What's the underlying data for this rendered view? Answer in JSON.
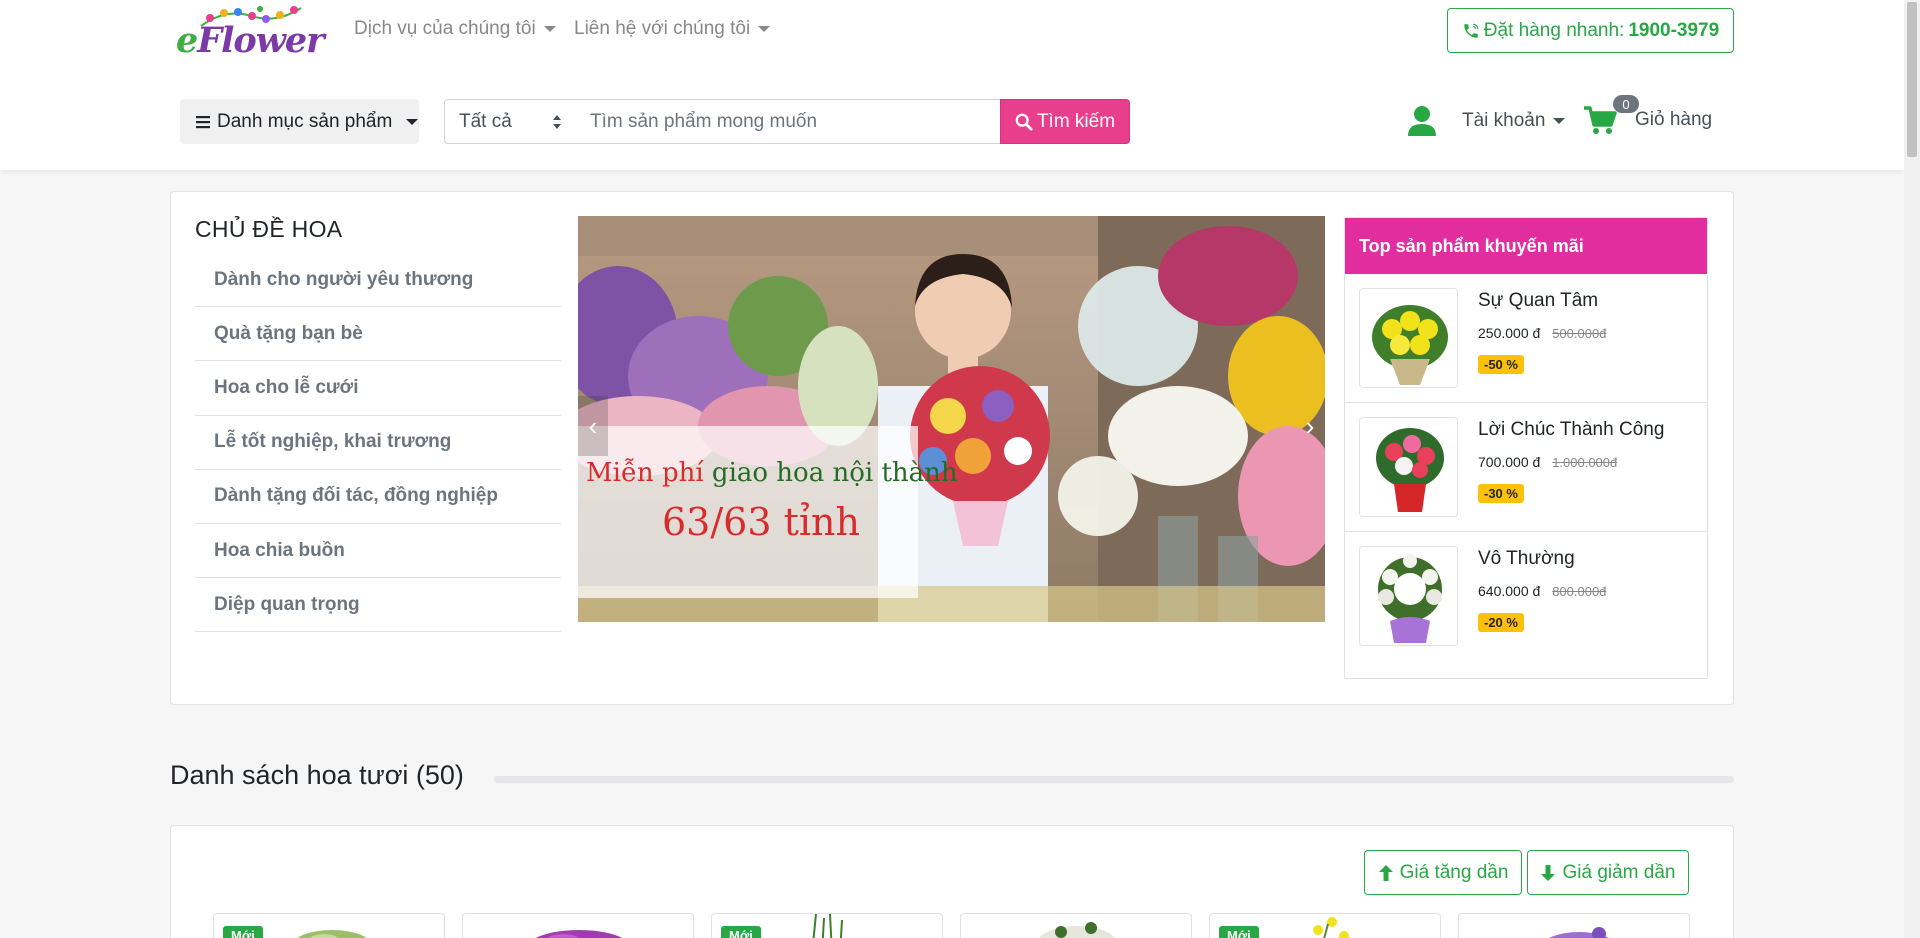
{
  "header": {
    "logo_text": "eFlower",
    "nav": [
      {
        "label": "Dịch vụ của chúng tôi"
      },
      {
        "label": "Liên hệ với chúng tôi"
      }
    ],
    "hotline_label": "Đặt hàng nhanh:",
    "hotline_number": "1900-3979",
    "category_button": "Danh mục sản phẩm",
    "search": {
      "select_value": "Tất cả",
      "placeholder": "Tìm sản phẩm mong muốn",
      "button_label": "Tìm kiếm"
    },
    "account_label": "Tài khoản",
    "cart_label": "Giỏ hàng",
    "cart_count": "0"
  },
  "topics": {
    "title": "CHỦ ĐỀ HOA",
    "items": [
      {
        "label": "Dành cho người yêu thương"
      },
      {
        "label": "Quà tặng bạn bè"
      },
      {
        "label": "Hoa cho lễ cưới"
      },
      {
        "label": "Lễ tốt nghiệp, khai trương"
      },
      {
        "label": "Dành tặng đối tác, đồng nghiệp"
      },
      {
        "label": "Hoa chia buồn"
      },
      {
        "label": "Diệp quan trọng"
      }
    ]
  },
  "banner": {
    "line1_red": "Miễn phí",
    "line1_green": "giao hoa nội thành",
    "line2": "63/63 tỉnh"
  },
  "promo": {
    "title": "Top sản phẩm khuyến mãi",
    "items": [
      {
        "name": "Sự Quan Tâm",
        "price": "250.000 đ",
        "old_price": "500.000đ",
        "discount": "-50 %",
        "flower_color": "#f2e21a"
      },
      {
        "name": "Lời Chúc Thành Công",
        "price": "700.000 đ",
        "old_price": "1.000.000đ",
        "discount": "-30 %",
        "flower_color": "#e8405a"
      },
      {
        "name": "Vô Thường",
        "price": "640.000 đ",
        "old_price": "800.000đ",
        "discount": "-20 %",
        "flower_color": "#f4f4ee"
      }
    ]
  },
  "list": {
    "title": "Danh sách hoa tươi (50)",
    "sort_asc": "Giá tăng dần",
    "sort_desc": "Giá giảm dần",
    "new_badge": "Mới",
    "products": [
      {
        "is_new": true
      },
      {
        "is_new": false
      },
      {
        "is_new": true
      },
      {
        "is_new": false
      },
      {
        "is_new": true
      },
      {
        "is_new": false
      }
    ]
  },
  "colors": {
    "accent_pink": "#e83e8c",
    "accent_green": "#28a745",
    "promo_header": "#e22d9e",
    "discount_badge": "#ffc107"
  }
}
